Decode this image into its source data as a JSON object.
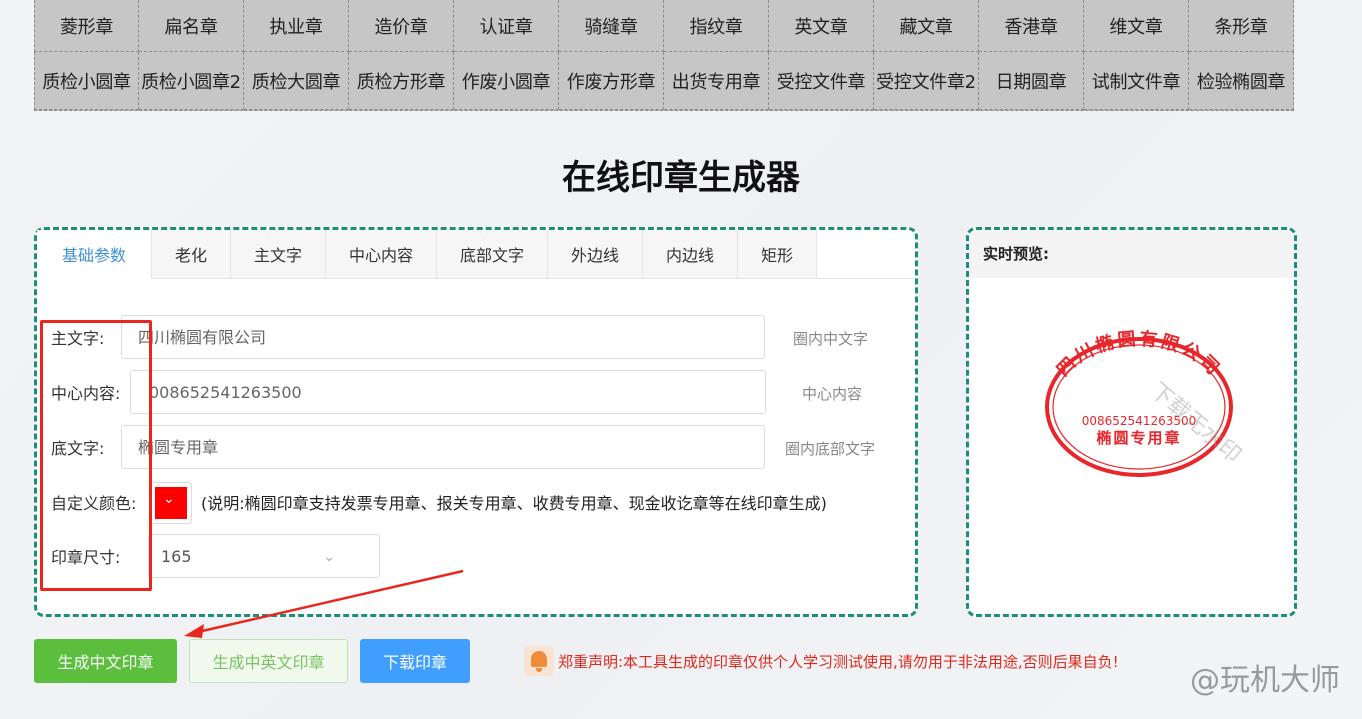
{
  "stamp_types": {
    "row1": [
      "菱形章",
      "扁名章",
      "执业章",
      "造价章",
      "认证章",
      "骑缝章",
      "指纹章",
      "英文章",
      "藏文章",
      "香港章",
      "维文章",
      "条形章"
    ],
    "row2": [
      "质检小圆章",
      "质检小圆章2",
      "质检大圆章",
      "质检方形章",
      "作废小圆章",
      "作废方形章",
      "出货专用章",
      "受控文件章",
      "受控文件章2",
      "日期圆章",
      "试制文件章",
      "检验椭圆章"
    ]
  },
  "page_title": "在线印章生成器",
  "tabs": [
    "基础参数",
    "老化",
    "主文字",
    "中心内容",
    "底部文字",
    "外边线",
    "内边线",
    "矩形"
  ],
  "form": {
    "main_text": {
      "label": "主文字:",
      "value": "四川椭圆有限公司",
      "hint": "圈内中文字"
    },
    "center": {
      "label": "中心内容:",
      "value": "008652541263500",
      "hint": "中心内容"
    },
    "bottom": {
      "label": "底文字:",
      "value": "椭圆专用章",
      "hint": "圈内底部文字"
    },
    "color": {
      "label": "自定义颜色:",
      "value": "#ff0000",
      "note": "(说明:椭圆印章支持发票专用章、报关专用章、收费专用章、现金收讫章等在线印章生成)"
    },
    "size": {
      "label": "印章尺寸:",
      "value": "165"
    }
  },
  "preview": {
    "title": "实时预览:",
    "seal_top": "四川椭圆有限公司",
    "seal_center": "008652541263500",
    "seal_bottom": "椭圆专用章",
    "seal_watermark": "下载无水印",
    "seal_color": "#e8262b"
  },
  "buttons": {
    "gen_cn": "生成中文印章",
    "gen_cn_en": "生成中英文印章",
    "download": "下载印章"
  },
  "notice": "郑重声明:本工具生成的印章仅供个人学习测试使用,请勿用于非法用途,否则后果自负!",
  "watermark": "@玩机大师",
  "accent": {
    "panel_border": "#1a8f7a",
    "tab_active": "#3f8fd6",
    "annot_red": "#e8261b"
  }
}
